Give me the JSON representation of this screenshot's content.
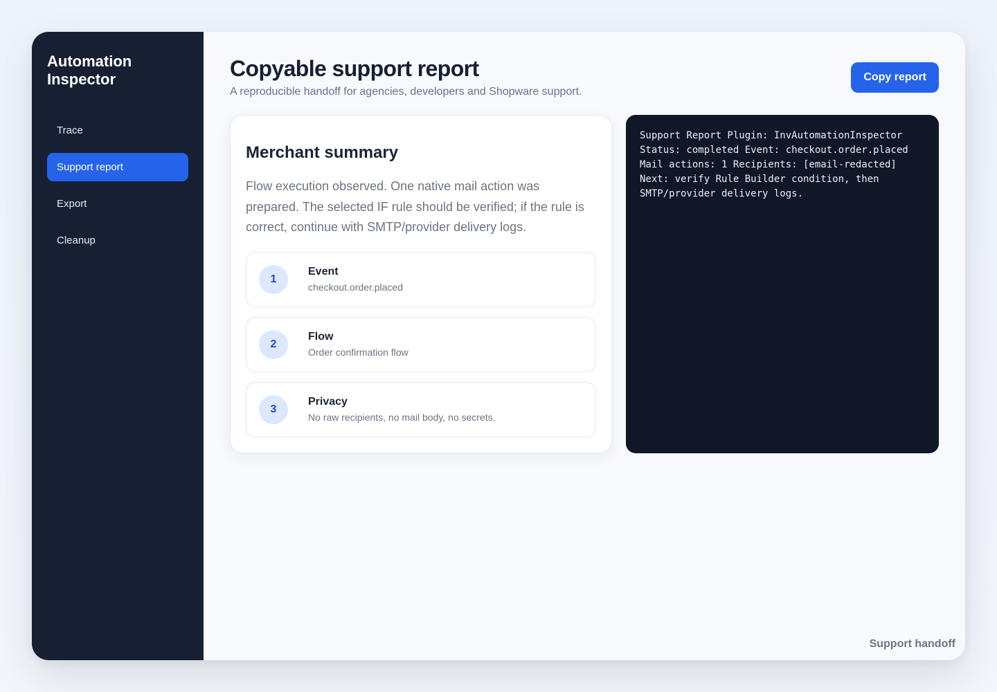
{
  "sidebar": {
    "brand_line1": "Automation",
    "brand_line2": "Inspector",
    "items": [
      {
        "label": "Trace",
        "active": false
      },
      {
        "label": "Support report",
        "active": true
      },
      {
        "label": "Export",
        "active": false
      },
      {
        "label": "Cleanup",
        "active": false
      }
    ]
  },
  "header": {
    "title": "Copyable support report",
    "subtitle": "A reproducible handoff for agencies, developers and Shopware support.",
    "copy_button": "Copy report"
  },
  "summary": {
    "title": "Merchant summary",
    "text": "Flow execution observed. One native mail action was prepared. The selected IF rule should be verified; if the rule is correct, continue with SMTP/provider delivery logs.",
    "steps": [
      {
        "number": "1",
        "title": "Event",
        "desc": "checkout.order.placed"
      },
      {
        "number": "2",
        "title": "Flow",
        "desc": "Order confirmation flow"
      },
      {
        "number": "3",
        "title": "Privacy",
        "desc": "No raw recipients, no mail body, no secrets."
      }
    ]
  },
  "report": {
    "text": "Support Report Plugin: InvAutomationInspector\nStatus: completed Event: checkout.order.placed\nMail actions: 1 Recipients: [email-redacted]\nNext: verify Rule Builder condition, then\nSMTP/provider delivery logs."
  },
  "footer": {
    "label": "Support handoff"
  },
  "colors": {
    "accent": "#2563eb",
    "sidebar_bg": "#172033",
    "code_bg": "#101828"
  }
}
